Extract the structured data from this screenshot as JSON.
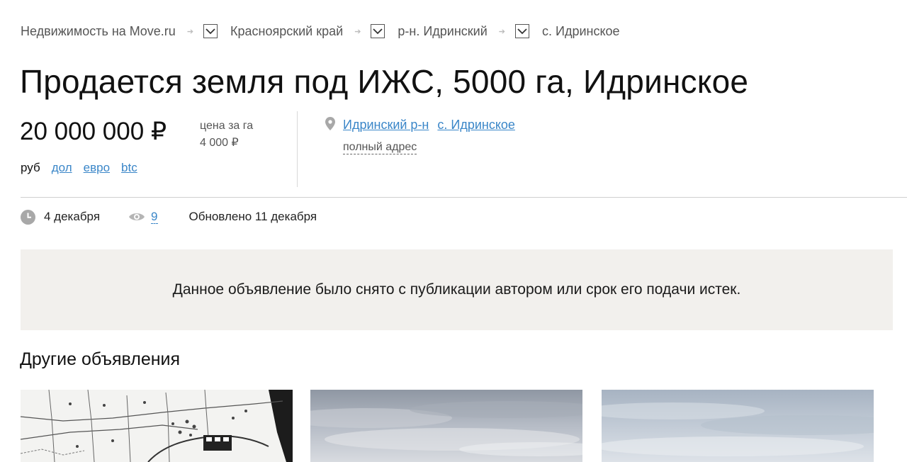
{
  "breadcrumbs": [
    {
      "label": "Недвижимость на Move.ru"
    },
    {
      "label": "Красноярский край"
    },
    {
      "label": "р-н. Идринский"
    },
    {
      "label": "с. Идринское"
    }
  ],
  "title": "Продается земля под ИЖС, 5000 га, Идринское",
  "price": {
    "value": "20 000 000 ₽",
    "unit_label": "цена за га",
    "unit_value": "4 000 ₽",
    "currencies": {
      "active": "руб",
      "links": [
        "дол",
        "евро",
        "btc"
      ]
    }
  },
  "location": {
    "district_link": "Идринский р-н",
    "village_link": "с. Идринское",
    "full_address_label": "полный адрес"
  },
  "meta": {
    "date": "4 декабря",
    "views": "9",
    "updated": "Обновлено 11 декабря"
  },
  "notice": "Данное объявление было снято с публикации автором или срок его подачи истек.",
  "other_listings": {
    "title": "Другие объявления",
    "cards": [
      {
        "photo": "cadastral-map-photo"
      },
      {
        "photo": "cloudy-sky-photo"
      },
      {
        "photo": "cloudy-sky-photo"
      }
    ]
  },
  "colors": {
    "link": "#3a86c8",
    "notice_bg": "#f2f0ed",
    "divider": "#cfcfcf",
    "icon_gray": "#a8a8a8"
  }
}
